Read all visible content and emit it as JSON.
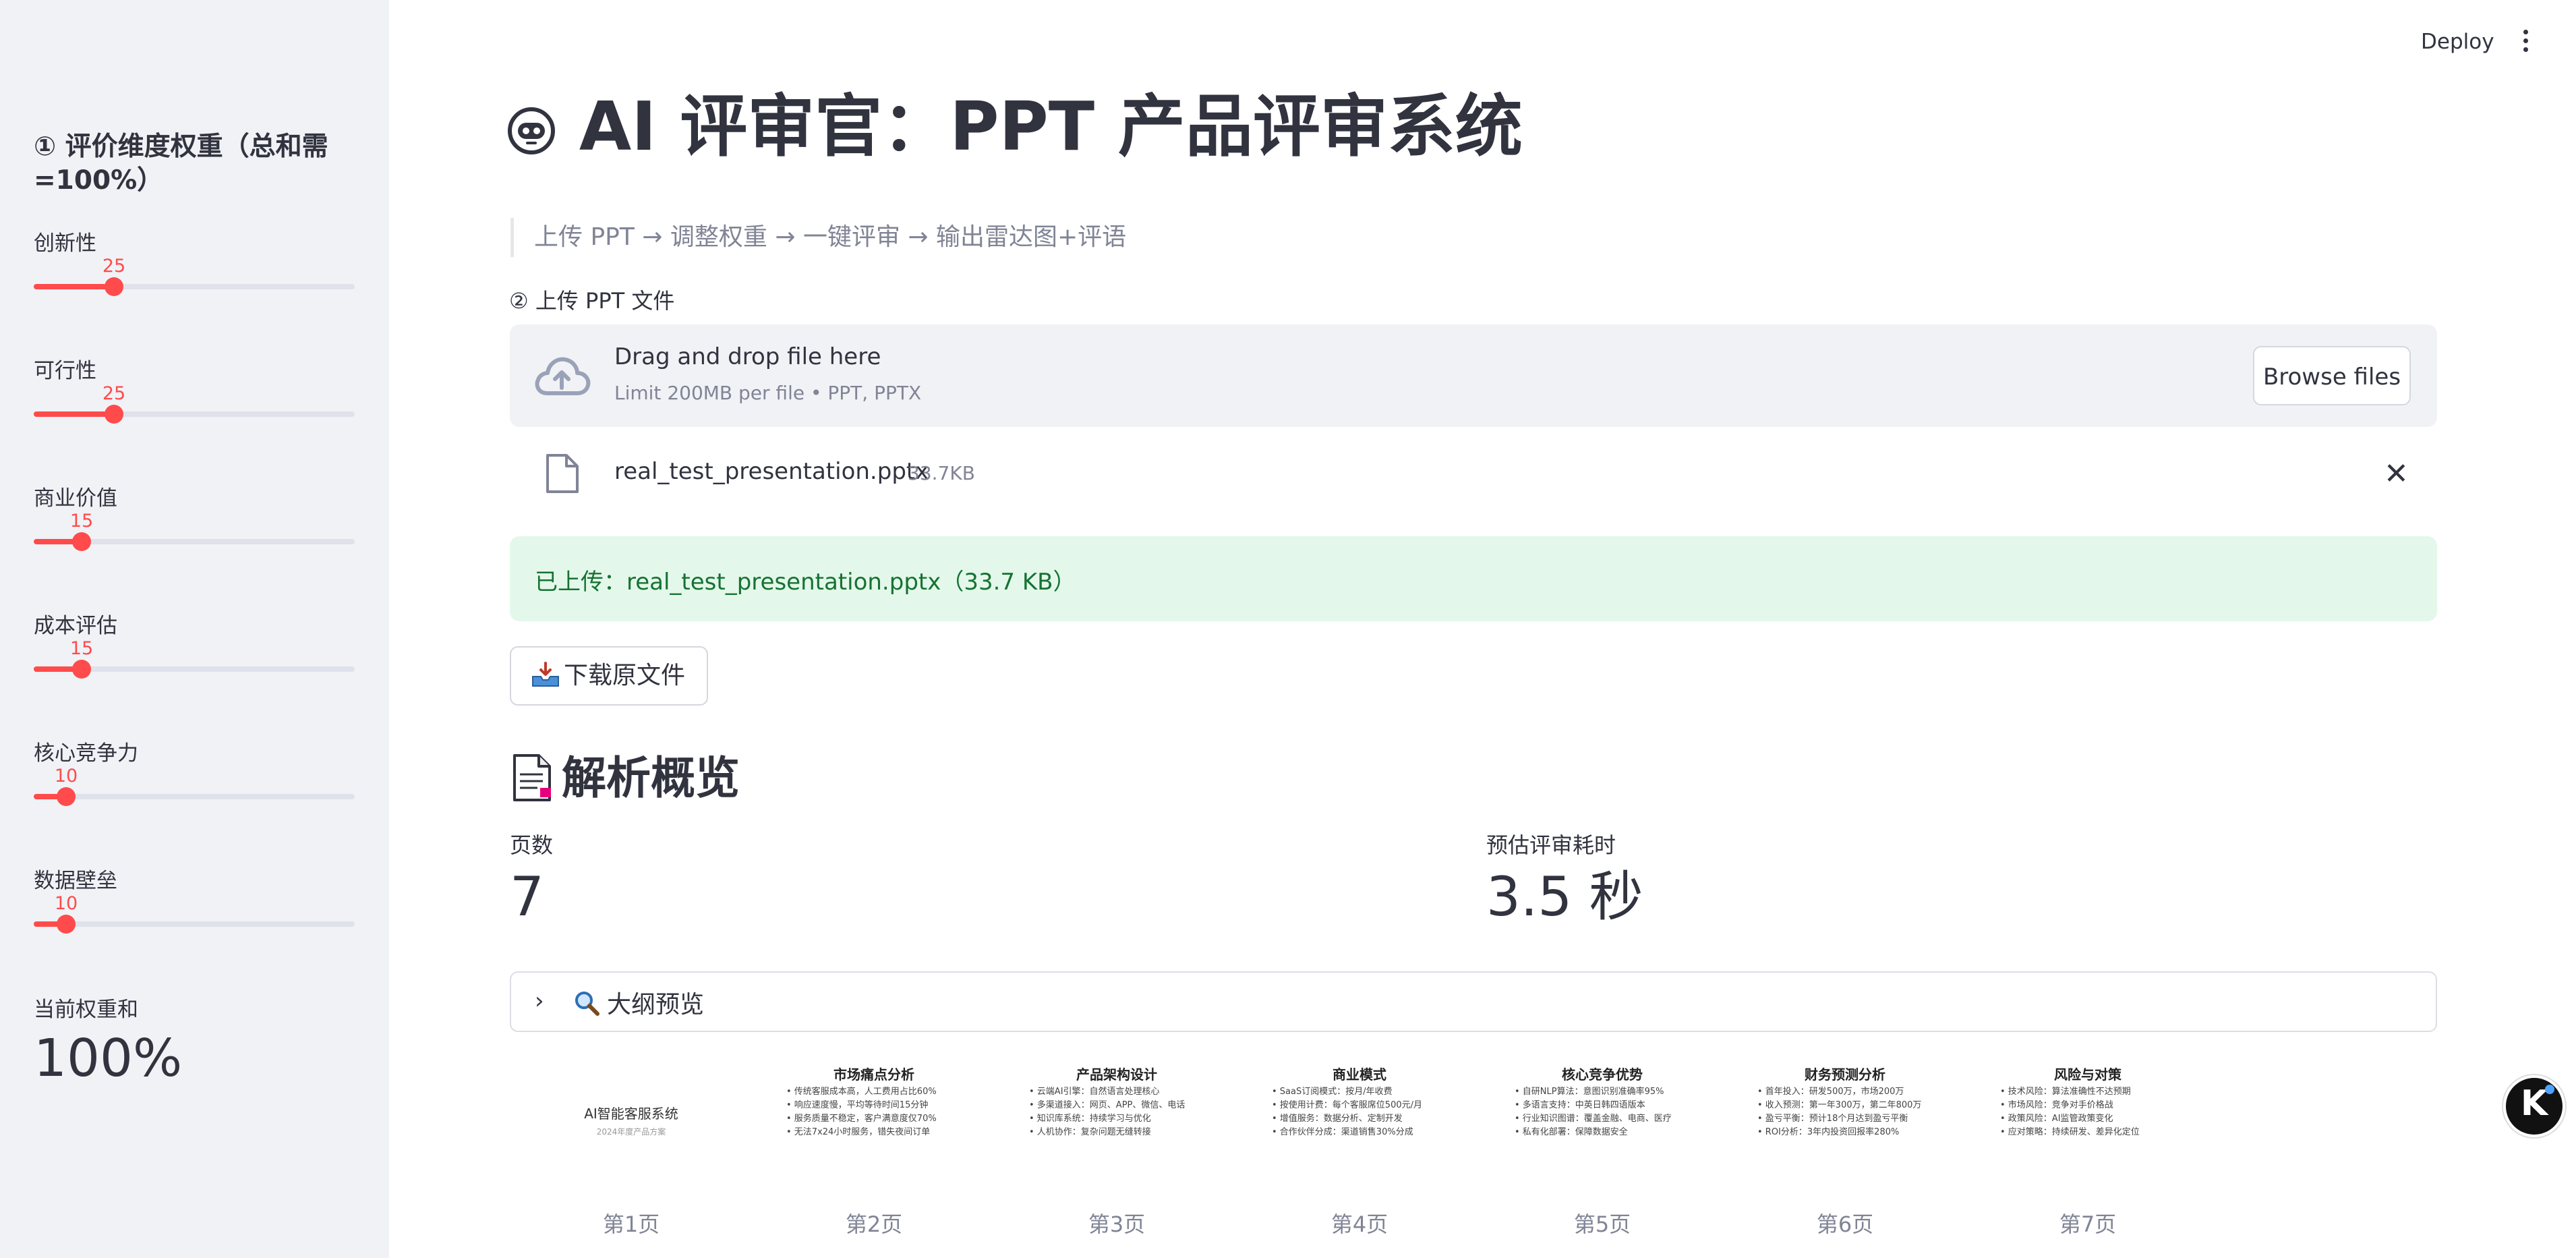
{
  "header": {
    "deploy_label": "Deploy"
  },
  "sidebar": {
    "heading": "① 评价维度权重（总和需=100%）",
    "sliders": [
      {
        "label": "创新性",
        "value": "25",
        "fraction": 0.25
      },
      {
        "label": "可行性",
        "value": "25",
        "fraction": 0.25
      },
      {
        "label": "商业价值",
        "value": "15",
        "fraction": 0.15
      },
      {
        "label": "成本评估",
        "value": "15",
        "fraction": 0.15
      },
      {
        "label": "核心竞争力",
        "value": "10",
        "fraction": 0.1
      },
      {
        "label": "数据壁垒",
        "value": "10",
        "fraction": 0.1
      }
    ],
    "total_label": "当前权重和",
    "total_value": "100%"
  },
  "main": {
    "title": "AI 评审官：PPT 产品评审系统",
    "caption": "上传 PPT → 调整权重 → 一键评审 → 输出雷达图+评语",
    "upload_label": "② 上传 PPT 文件",
    "dropzone": {
      "title": "Drag and drop file here",
      "limit": "Limit 200MB per file • PPT, PPTX",
      "browse_label": "Browse files"
    },
    "file": {
      "name": "real_test_presentation.pptx",
      "size": "33.7KB"
    },
    "success_message": "已上传：real_test_presentation.pptx（33.7 KB）",
    "download_label": "下载原文件",
    "section_heading": "解析概览",
    "metrics": [
      {
        "label": "页数",
        "value": "7"
      },
      {
        "label": "预估评审耗时",
        "value": "3.5 秒"
      }
    ],
    "expander_label": "大纲预览",
    "thumbnails": [
      {
        "title": "AI智能客服系统",
        "subtitle": "2024年度产品方案",
        "lines": [],
        "page_label": "第1页"
      },
      {
        "title": "市场痛点分析",
        "subtitle": "",
        "lines": [
          "• 传统客服成本高，人工费用占比60%",
          "• 响应速度慢，平均等待时间15分钟",
          "• 服务质量不稳定，客户满意度仅70%",
          "• 无法7x24小时服务，错失夜间订单"
        ],
        "page_label": "第2页"
      },
      {
        "title": "产品架构设计",
        "subtitle": "",
        "lines": [
          "• 云端AI引擎：自然语言处理核心",
          "• 多渠道接入：网页、APP、微信、电话",
          "• 知识库系统：持续学习与优化",
          "• 人机协作：复杂问题无缝转接"
        ],
        "page_label": "第3页"
      },
      {
        "title": "商业模式",
        "subtitle": "",
        "lines": [
          "• SaaS订阅模式：按月/年收费",
          "• 按使用计费：每个客服席位500元/月",
          "• 增值服务：数据分析、定制开发",
          "• 合作伙伴分成：渠道销售30%分成"
        ],
        "page_label": "第4页"
      },
      {
        "title": "核心竞争优势",
        "subtitle": "",
        "lines": [
          "• 自研NLP算法：意图识别准确率95%",
          "• 多语言支持：中英日韩四语版本",
          "• 行业知识图谱：覆盖金融、电商、医疗",
          "• 私有化部署：保障数据安全"
        ],
        "page_label": "第5页"
      },
      {
        "title": "财务预测分析",
        "subtitle": "",
        "lines": [
          "• 首年投入：研发500万，市场200万",
          "• 收入预测：第一年300万，第二年800万",
          "• 盈亏平衡：预计18个月达到盈亏平衡",
          "• ROI分析：3年内投资回报率280%"
        ],
        "page_label": "第6页"
      },
      {
        "title": "风险与对策",
        "subtitle": "",
        "lines": [
          "• 技术风险：算法准确性不达预期",
          "• 市场风险：竞争对手价格战",
          "• 政策风险：AI监管政策变化",
          "• 应对策略：持续研发、差异化定位"
        ],
        "page_label": "第7页"
      }
    ]
  },
  "colors": {
    "accent": "#ff4b4b",
    "success_bg": "#e3f8ea",
    "success_text": "#177233",
    "sidebar_bg": "#f0f2f6"
  }
}
